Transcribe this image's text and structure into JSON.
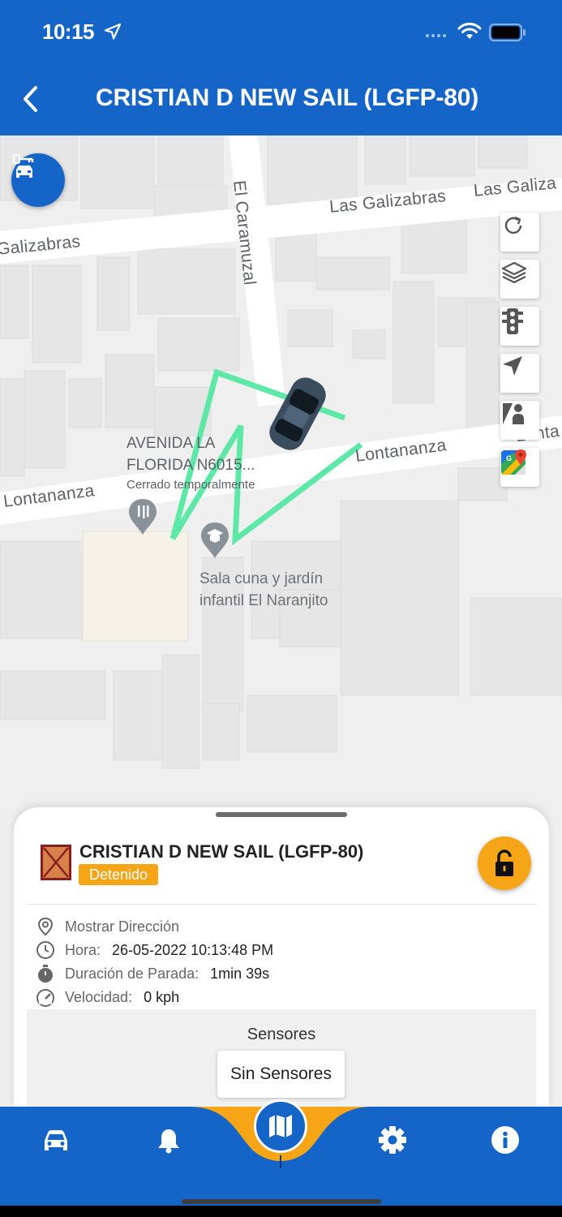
{
  "status_bar": {
    "time": "10:15"
  },
  "header": {
    "title": "CRISTIAN D NEW SAIL (LGFP-80)"
  },
  "map": {
    "labels": {
      "street_galizabras_right": "Las Galizabras",
      "street_galiza_edge": "Las Galiza",
      "street_galizabras_left": "Galizabras",
      "street_caramuzal": "El Caramuzal",
      "street_lontananza_left": "Lontananza",
      "street_lontananza_right": "Lontananza",
      "street_lonta_edge": "Lonta",
      "poi_avenida_line1": "AVENIDA LA",
      "poi_avenida_line2": "FLORIDA N6015...",
      "poi_avenida_status": "Cerrado temporalmente",
      "poi_school_line1": "Sala cuna y jardín",
      "poi_school_line2": "infantil El Naranjito"
    },
    "route_color": "#5ee8a8",
    "tools": [
      "refresh-icon",
      "layers-icon",
      "traffic-light-icon",
      "navigation-icon",
      "street-view-icon",
      "google-maps-icon"
    ]
  },
  "sheet": {
    "vehicle_name": "CRISTIAN D NEW SAIL (LGFP-80)",
    "status": "Detenido",
    "status_color": "#f6a516",
    "address_label": "Mostrar Dirección",
    "time_label": "Hora:",
    "time_value": "26-05-2022 10:13:48 PM",
    "stop_label": "Duración de Parada:",
    "stop_value": "1min 39s",
    "speed_label": "Velocidad:",
    "speed_value": "0 kph",
    "sensors_title": "Sensores",
    "sensors_empty": "Sin Sensores"
  },
  "nav": {
    "items": [
      "car-icon",
      "bell-icon",
      "map-icon",
      "gear-icon",
      "info-icon"
    ],
    "active": "map-icon",
    "primary_color": "#1565c8",
    "accent_color": "#f6a516"
  }
}
